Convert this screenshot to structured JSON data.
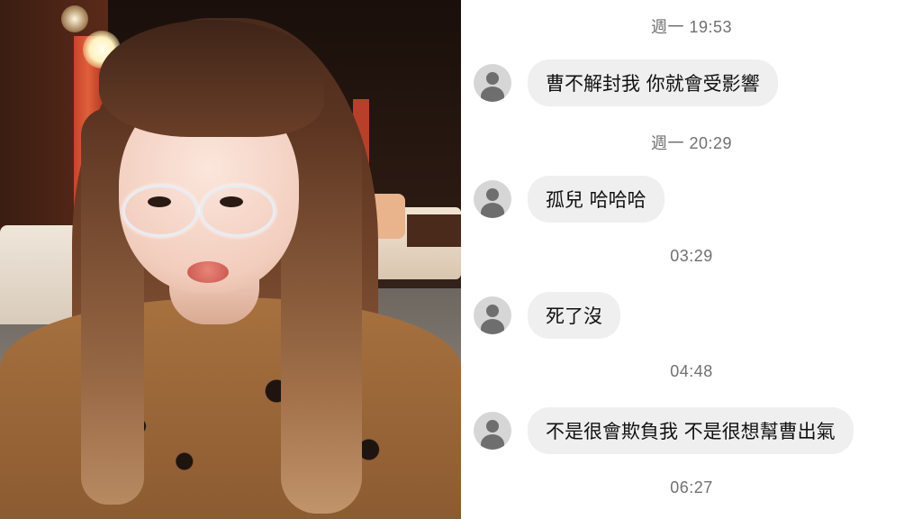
{
  "chat": {
    "messages": [
      {
        "timestamp": "週一 19:53",
        "text": "曹不解封我 你就會受影響"
      },
      {
        "timestamp": "週一 20:29",
        "text": "孤兒 哈哈哈"
      },
      {
        "timestamp": "03:29",
        "text": "死了沒"
      },
      {
        "timestamp": "04:48",
        "text": "不是很會欺負我 不是很想幫曹出氣"
      },
      {
        "timestamp": "06:27",
        "text": ""
      }
    ]
  },
  "icons": {
    "avatar": "person-silhouette-icon"
  },
  "colors": {
    "bubble": "#efefef",
    "timestamp": "#707070",
    "avatar_bg": "#d6d6d6",
    "avatar_fg": "#6e6e6e"
  }
}
